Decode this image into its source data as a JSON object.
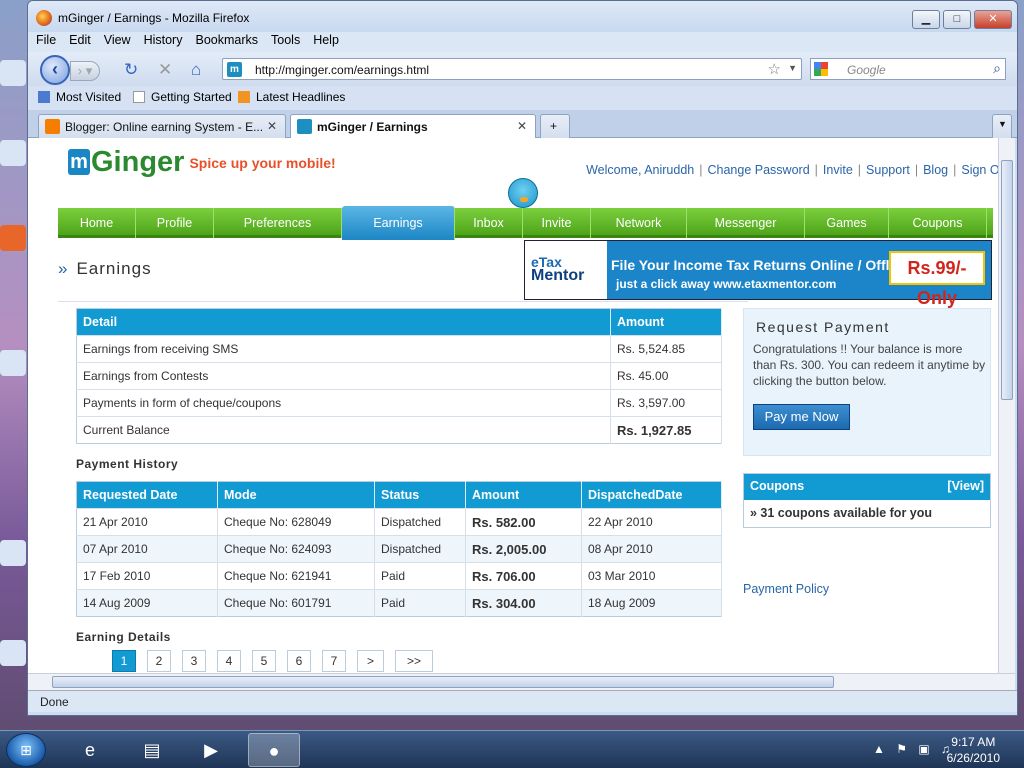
{
  "window": {
    "title": "mGinger / Earnings - Mozilla Firefox",
    "minimize": "▁",
    "maximize": "□",
    "close": "✕"
  },
  "menu": [
    "File",
    "Edit",
    "View",
    "History",
    "Bookmarks",
    "Tools",
    "Help"
  ],
  "navbar": {
    "url": "http://mginger.com/earnings.html",
    "search_placeholder": "Google"
  },
  "bookmarks": [
    "Most Visited",
    "Getting Started",
    "Latest Headlines"
  ],
  "tabs": [
    {
      "label": "Blogger: Online earning System - E...",
      "active": false
    },
    {
      "label": "mGinger / Earnings",
      "active": true
    }
  ],
  "site": {
    "logo_m": "m",
    "logo_name": "Ginger",
    "tagline": "Spice up your mobile!",
    "top_links": [
      "Welcome, Aniruddh",
      "Change Password",
      "Invite",
      "Support",
      "Blog",
      "Sign Out"
    ],
    "nav": [
      "Home",
      "Profile",
      "Preferences",
      "Earnings",
      "Inbox",
      "Invite",
      "Network",
      "Messenger",
      "Games",
      "Coupons"
    ],
    "active_nav": "Earnings",
    "page_title": "Earnings",
    "page_title_mark": "»"
  },
  "ad": {
    "brand_top": "eTax",
    "brand_bottom": "Mentor",
    "line1": "File Your Income Tax Returns Online / Offline @",
    "line2": "just a click away   www.etaxmentor.com",
    "price": "Rs.99/- Only"
  },
  "summary": {
    "headers": [
      "Detail",
      "Amount"
    ],
    "rows": [
      [
        "Earnings from receiving SMS",
        "Rs. 5,524.85"
      ],
      [
        "Earnings from Contests",
        "Rs. 45.00"
      ],
      [
        "Payments in form of cheque/coupons",
        "Rs. 3,597.00"
      ],
      [
        "Current Balance",
        "Rs. 1,927.85"
      ]
    ]
  },
  "payment_history": {
    "title": "Payment History",
    "headers": [
      "Requested Date",
      "Mode",
      "Status",
      "Amount",
      "DispatchedDate"
    ],
    "rows": [
      [
        "21 Apr 2010",
        "Cheque No: 628049",
        "Dispatched",
        "Rs. 582.00",
        "22 Apr 2010"
      ],
      [
        "07 Apr 2010",
        "Cheque No: 624093",
        "Dispatched",
        "Rs. 2,005.00",
        "08 Apr 2010"
      ],
      [
        "17 Feb 2010",
        "Cheque No: 621941",
        "Paid",
        "Rs. 706.00",
        "03 Mar 2010"
      ],
      [
        "14 Aug 2009",
        "Cheque No: 601791",
        "Paid",
        "Rs. 304.00",
        "18 Aug 2009"
      ]
    ]
  },
  "earning_details": {
    "title": "Earning Details",
    "pages": [
      "1",
      "2",
      "3",
      "4",
      "5",
      "6",
      "7",
      ">",
      ">>"
    ],
    "current_page": "1"
  },
  "request_payment": {
    "title": "Request Payment",
    "text": "Congratulations !! Your balance is more than Rs. 300. You can redeem it anytime by clicking the button below.",
    "button": "Pay me Now"
  },
  "coupons": {
    "title": "Coupons",
    "view": "[View]",
    "text": "» 31 coupons available for you"
  },
  "payment_policy": "Payment Policy",
  "status": "Done",
  "taskbar": {
    "time": "9:17 AM",
    "date": "6/26/2010"
  },
  "colors": {
    "accent_blue": "#129ad2",
    "nav_green": "#5cb627",
    "link": "#2a65a8",
    "tagline": "#e8502a"
  }
}
